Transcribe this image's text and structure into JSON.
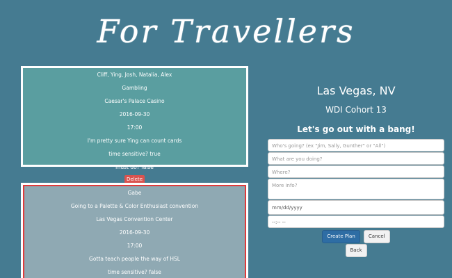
{
  "header": {
    "title": "For Travellers"
  },
  "cards": [
    {
      "who": "Cliff, Ying, Josh, Natalia, Alex",
      "what": "Gambling",
      "where": "Caesar's Palace Casino",
      "date": "2016-09-30",
      "time": "17:00",
      "info": "I'm pretty sure Ying can count cards",
      "time_sensitive": "time sensitive? true",
      "must_do": "must do? false",
      "delete_label": "Delete"
    },
    {
      "who": "Gabe",
      "what": "Going to a Palette & Color Enthusiast convention",
      "where": "Las Vegas Convention Center",
      "date": "2016-09-30",
      "time": "17:00",
      "info": "Gotta teach people the way of HSL",
      "time_sensitive": "time sensitive? false"
    }
  ],
  "panel": {
    "city": "Las Vegas, NV",
    "cohort": "WDI Cohort 13",
    "tagline": "Let's go out with a bang!"
  },
  "form": {
    "who_placeholder": "Who's going? (ex \"Jim, Sally, Gunther\" or \"All\")",
    "what_placeholder": "What are you doing?",
    "where_placeholder": "Where?",
    "info_placeholder": "More info?",
    "date_placeholder": "mm/dd/yyyy",
    "time_placeholder": "--:-- --",
    "create_label": "Create Plan",
    "cancel_label": "Cancel",
    "back_label": "Back"
  },
  "colors": {
    "background": "#457b91",
    "card_teal": "#5a9ea0",
    "card_gray": "#8fa9b3",
    "highlight_border": "#e03a3a",
    "delete_red": "#d9534f",
    "primary_blue": "#2e6da4"
  }
}
